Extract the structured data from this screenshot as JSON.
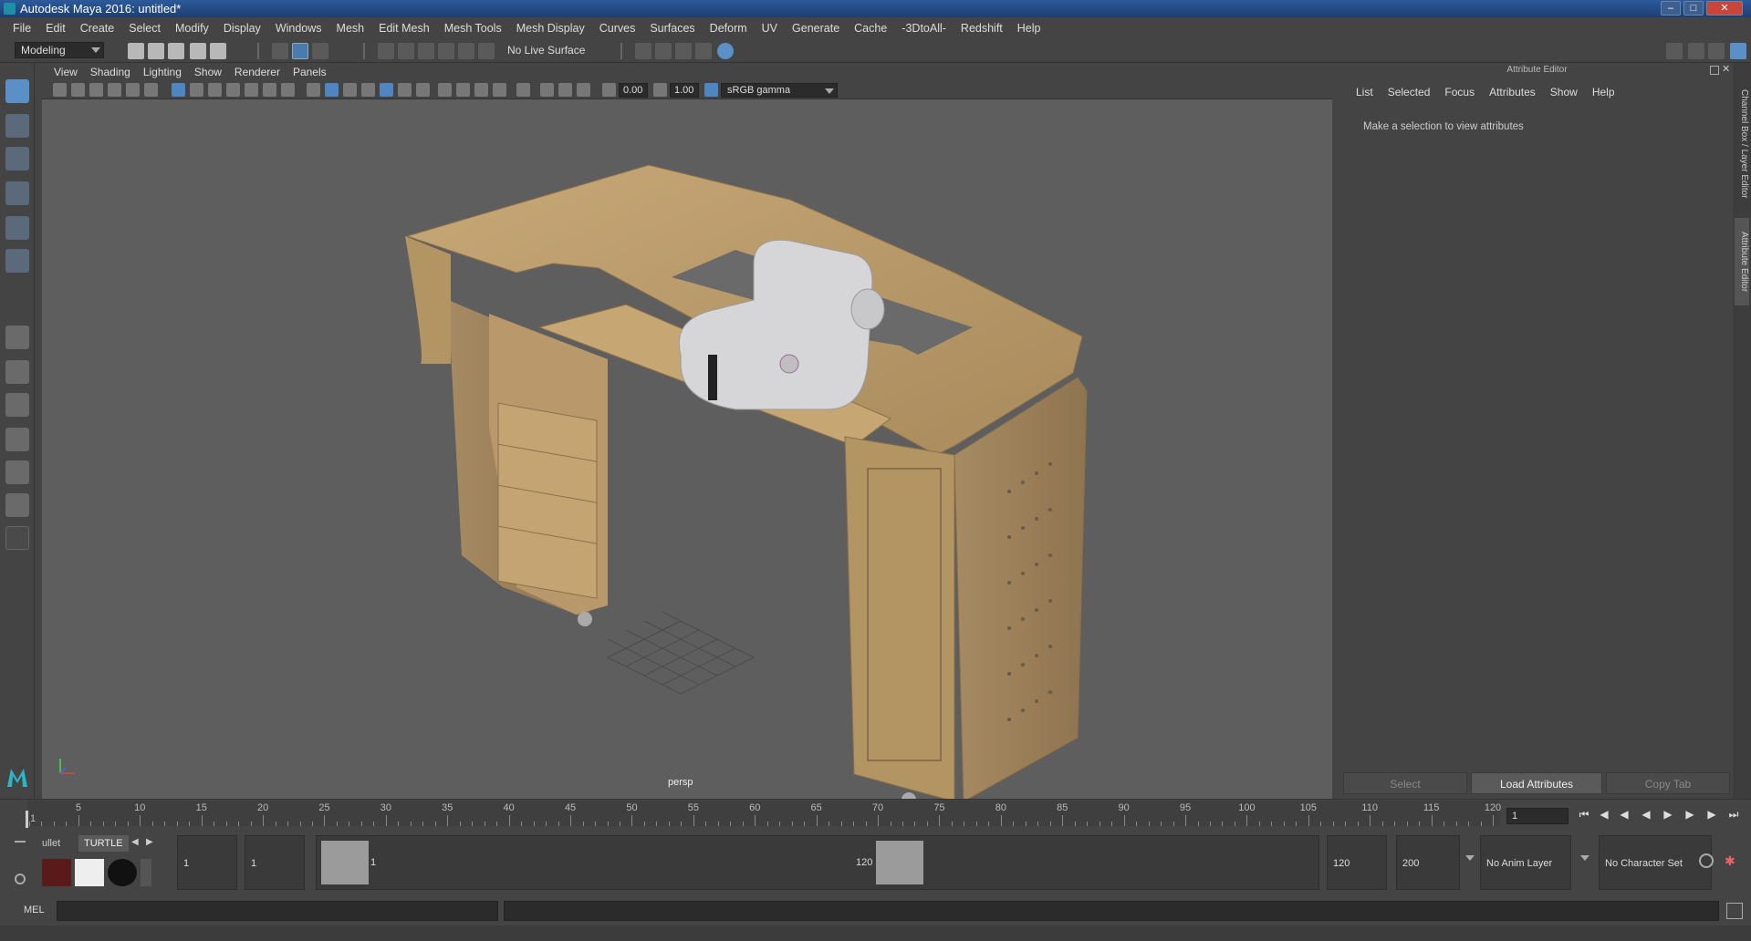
{
  "window": {
    "title": "Autodesk Maya 2016: untitled*"
  },
  "menubar": [
    "File",
    "Edit",
    "Create",
    "Select",
    "Modify",
    "Display",
    "Windows",
    "Mesh",
    "Edit Mesh",
    "Mesh Tools",
    "Mesh Display",
    "Curves",
    "Surfaces",
    "Deform",
    "UV",
    "Generate",
    "Cache",
    "-3DtoAll-",
    "Redshift",
    "Help"
  ],
  "toolbar": {
    "mode": "Modeling",
    "live_surface": "No Live Surface"
  },
  "viewport": {
    "menu": [
      "View",
      "Shading",
      "Lighting",
      "Show",
      "Renderer",
      "Panels"
    ],
    "exposure": "0.00",
    "gamma": "1.00",
    "color_space": "sRGB gamma",
    "camera_label": "persp"
  },
  "attribute_editor": {
    "title": "Attribute Editor",
    "menu": [
      "List",
      "Selected",
      "Focus",
      "Attributes",
      "Show",
      "Help"
    ],
    "message": "Make a selection to view attributes",
    "buttons": {
      "select": "Select",
      "load": "Load Attributes",
      "copy": "Copy Tab"
    }
  },
  "side_tabs": {
    "channel_box": "Channel Box / Layer Editor",
    "attribute_editor": "Attribute Editor"
  },
  "timeline": {
    "ticks": [
      "1",
      "5",
      "10",
      "15",
      "20",
      "25",
      "30",
      "35",
      "40",
      "45",
      "50",
      "55",
      "60",
      "65",
      "70",
      "75",
      "80",
      "85",
      "90",
      "95",
      "100",
      "105",
      "110",
      "115",
      "120"
    ],
    "current_frame": "1"
  },
  "range": {
    "start": "1",
    "playback_start": "1",
    "range_start_label": "1",
    "range_end_label": "120",
    "playback_end": "120",
    "end": "200",
    "anim_layer": "No Anim Layer",
    "character_set": "No Character Set"
  },
  "shelf": {
    "tabs": [
      "ullet",
      "TURTLE"
    ]
  },
  "command_line": {
    "label": "MEL"
  }
}
